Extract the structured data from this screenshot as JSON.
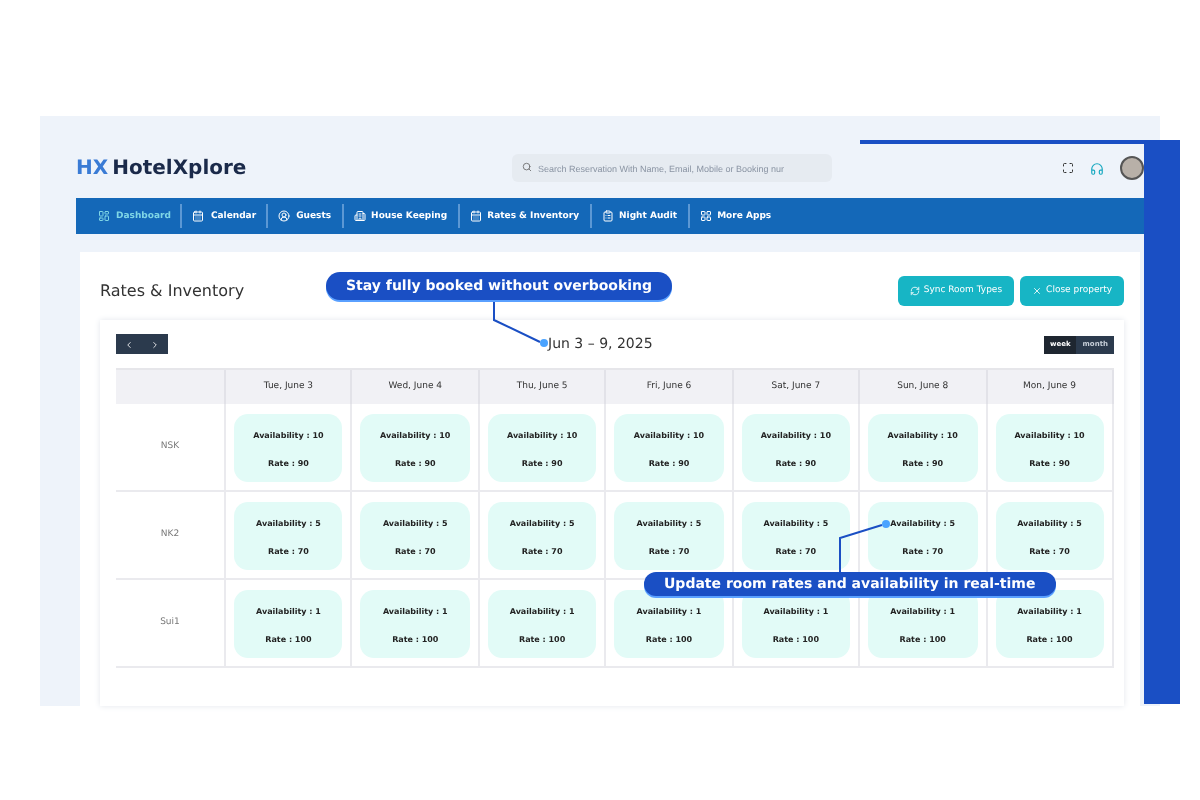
{
  "brand": {
    "mark": "HX",
    "name": "HotelXplore"
  },
  "search": {
    "placeholder": "Search Reservation With Name, Email, Mobile or Booking nur"
  },
  "nav": [
    {
      "label": "Dashboard",
      "selected": true
    },
    {
      "label": "Calendar",
      "selected": false
    },
    {
      "label": "Guests",
      "selected": false
    },
    {
      "label": "House Keeping",
      "selected": false
    },
    {
      "label": "Rates & Inventory",
      "selected": false
    },
    {
      "label": "Night Audit",
      "selected": false
    },
    {
      "label": "More Apps",
      "selected": false
    }
  ],
  "page": {
    "title": "Rates & Inventory",
    "buttons": [
      {
        "label": "Sync Room Types"
      },
      {
        "label": "Close property"
      }
    ]
  },
  "range": "Jun 3 – 9, 2025",
  "view_toggle": [
    {
      "label": "week",
      "selected": true
    },
    {
      "label": "month",
      "selected": false
    }
  ],
  "table": {
    "columns": [
      "Tue, June 3",
      "Wed, June 4",
      "Thu, June 5",
      "Fri, June 6",
      "Sat, June 7",
      "Sun, June 8",
      "Mon, June 9"
    ],
    "rows": [
      {
        "room": "NSK",
        "cells": [
          {
            "availability": "Availability : 10",
            "rate": "Rate : 90"
          },
          {
            "availability": "Availability : 10",
            "rate": "Rate : 90"
          },
          {
            "availability": "Availability : 10",
            "rate": "Rate : 90"
          },
          {
            "availability": "Availability : 10",
            "rate": "Rate : 90"
          },
          {
            "availability": "Availability : 10",
            "rate": "Rate : 90"
          },
          {
            "availability": "Availability : 10",
            "rate": "Rate : 90"
          },
          {
            "availability": "Availability : 10",
            "rate": "Rate : 90"
          }
        ]
      },
      {
        "room": "NK2",
        "cells": [
          {
            "availability": "Availability : 5",
            "rate": "Rate : 70"
          },
          {
            "availability": "Availability : 5",
            "rate": "Rate : 70"
          },
          {
            "availability": "Availability : 5",
            "rate": "Rate : 70"
          },
          {
            "availability": "Availability : 5",
            "rate": "Rate : 70"
          },
          {
            "availability": "Availability : 5",
            "rate": "Rate : 70"
          },
          {
            "availability": "Availability : 5",
            "rate": "Rate : 70"
          },
          {
            "availability": "Availability : 5",
            "rate": "Rate : 70"
          }
        ]
      },
      {
        "room": "Sui1",
        "cells": [
          {
            "availability": "Availability : 1",
            "rate": "Rate : 100"
          },
          {
            "availability": "Availability : 1",
            "rate": "Rate : 100"
          },
          {
            "availability": "Availability : 1",
            "rate": "Rate : 100"
          },
          {
            "availability": "Availability : 1",
            "rate": "Rate : 100"
          },
          {
            "availability": "Availability : 1",
            "rate": "Rate : 100"
          },
          {
            "availability": "Availability : 1",
            "rate": "Rate : 100"
          },
          {
            "availability": "Availability : 1",
            "rate": "Rate : 100"
          }
        ]
      }
    ]
  },
  "callouts": [
    "Stay fully booked without overbooking",
    "Update room rates and availability in real-time"
  ]
}
